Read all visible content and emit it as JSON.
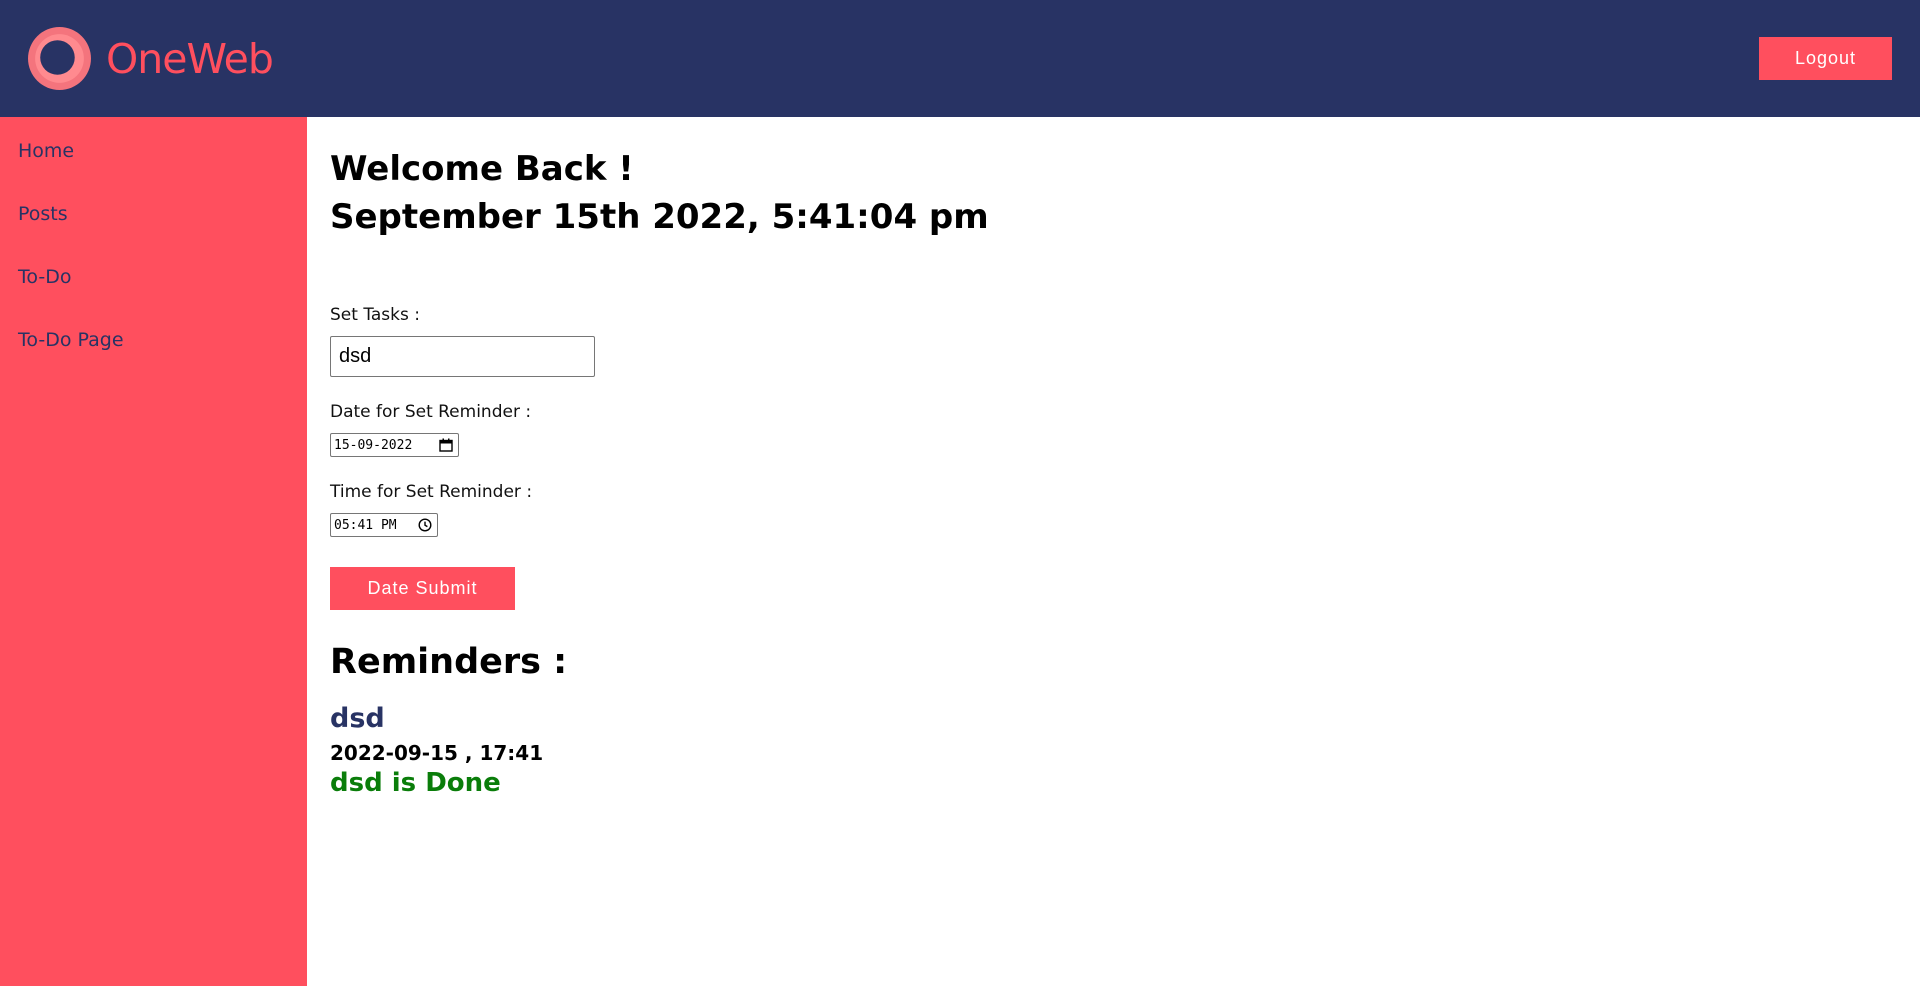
{
  "brand": {
    "name": "OneWeb"
  },
  "header": {
    "logout_label": "Logout"
  },
  "sidebar": {
    "items": [
      {
        "label": "Home"
      },
      {
        "label": "Posts"
      },
      {
        "label": "To-Do"
      },
      {
        "label": "To-Do Page"
      }
    ]
  },
  "main": {
    "welcome": "Welcome Back !",
    "datetime": "September 15th 2022, 5:41:04 pm",
    "form": {
      "task_label": "Set Tasks :",
      "task_value": "dsd",
      "date_label": "Date for Set Reminder :",
      "date_value": "15-09-2022",
      "time_label": "Time for Set Reminder :",
      "time_value": "05:41 PM",
      "submit_label": "Date Submit"
    },
    "reminders": {
      "heading": "Reminders :",
      "items": [
        {
          "task": "dsd",
          "datetime": "2022-09-15 , 17:41",
          "status": "dsd is Done"
        }
      ]
    }
  },
  "colors": {
    "header_bg": "#283364",
    "accent": "#ff4f5e",
    "done_green": "#0a7d0a"
  },
  "icons": {
    "logo": "ring-logo-icon",
    "calendar": "calendar-icon",
    "clock": "clock-icon"
  }
}
